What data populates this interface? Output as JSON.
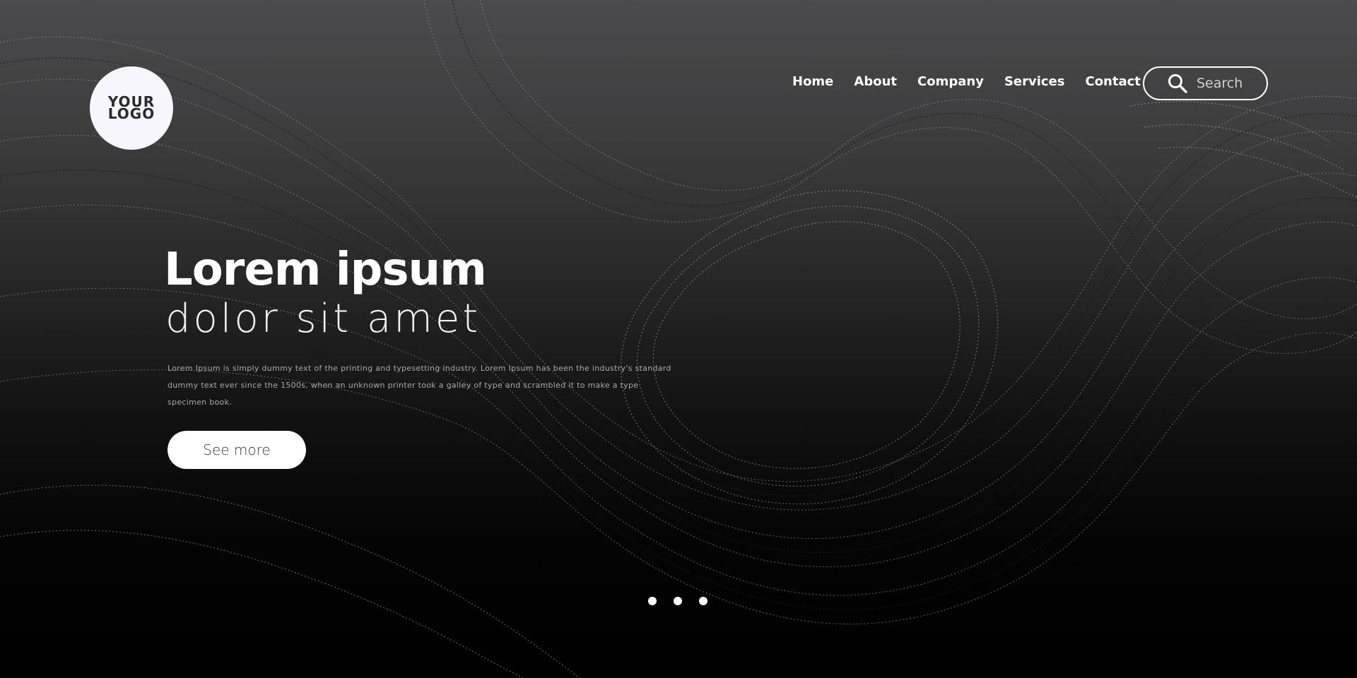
{
  "logo": {
    "line1": "YOUR",
    "line2": "LOGO"
  },
  "nav": {
    "items": [
      {
        "label": "Home"
      },
      {
        "label": "About"
      },
      {
        "label": "Company"
      },
      {
        "label": "Services"
      },
      {
        "label": "Contact"
      }
    ]
  },
  "search": {
    "placeholder": "Search",
    "icon": "search-icon"
  },
  "hero": {
    "title": "Lorem ipsum",
    "subtitle": "dolor sit amet",
    "body": "Lorem Ipsum is simply dummy text of the printing and typesetting industry. Lorem Ipsum has been the industry's standard dummy text ever since the 1500s, when an unknown printer took a galley of type and scrambled it to make a type specimen book.",
    "cta_label": "See more"
  },
  "pagination": {
    "count": 3
  },
  "colors": {
    "background_top": "#4b4b4d",
    "background_bottom": "#000000",
    "accent": "#ffffff",
    "logo_bg": "#f7f6fc"
  }
}
